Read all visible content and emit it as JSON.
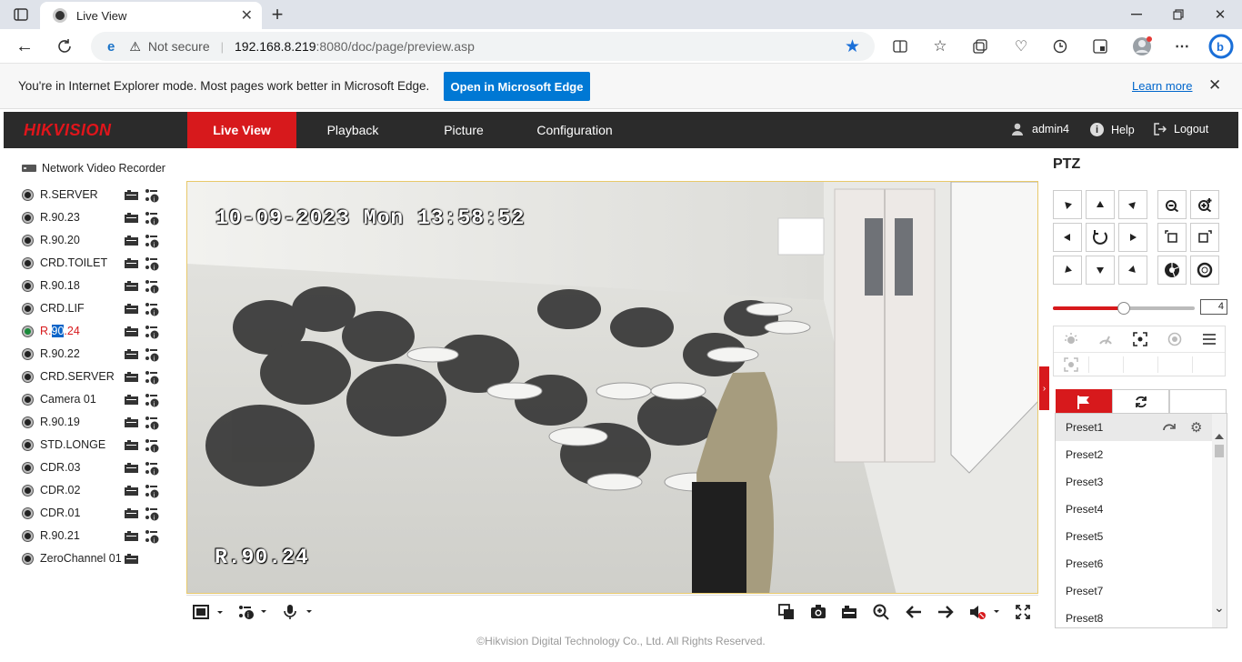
{
  "browser": {
    "tab_title": "Live View",
    "address_security": "Not secure",
    "address_host": "192.168.8.219",
    "address_rest": ":8080/doc/page/preview.asp"
  },
  "ie_banner": {
    "message": "You're in Internet Explorer mode. Most pages work better in Microsoft Edge.",
    "open_button": "Open in Microsoft Edge",
    "learn_more": "Learn more"
  },
  "app": {
    "logo": "HIKVISION",
    "nav": [
      "Live View",
      "Playback",
      "Picture",
      "Configuration"
    ],
    "active_nav": "Live View",
    "user": "admin4",
    "help": "Help",
    "logout": "Logout"
  },
  "tree": {
    "root": "Network Video Recorder",
    "cameras": [
      {
        "name": "R.SERVER"
      },
      {
        "name": "R.90.23"
      },
      {
        "name": "R.90.20"
      },
      {
        "name": "CRD.TOILET"
      },
      {
        "name": "R.90.18"
      },
      {
        "name": "CRD.LIF"
      },
      {
        "name_pre": "R.",
        "name_sel": "90",
        "name_post": ".24",
        "active": true
      },
      {
        "name": "R.90.22"
      },
      {
        "name": "CRD.SERVER"
      },
      {
        "name": "Camera 01"
      },
      {
        "name": "R.90.19"
      },
      {
        "name": "STD.LONGE"
      },
      {
        "name": "CDR.03"
      },
      {
        "name": "CDR.02"
      },
      {
        "name": "CDR.01"
      },
      {
        "name": "R.90.21"
      }
    ],
    "zero_channel": "ZeroChannel 01"
  },
  "video": {
    "timestamp": "10-09-2023 Mon 13:58:52",
    "camera_name": "R.90.24"
  },
  "ptz": {
    "title": "PTZ",
    "speed": "4",
    "speed_fraction": 0.5,
    "presets": [
      "Preset1",
      "Preset2",
      "Preset3",
      "Preset4",
      "Preset5",
      "Preset6",
      "Preset7",
      "Preset8"
    ]
  },
  "footer": "©Hikvision Digital Technology Co., Ltd. All Rights Reserved.",
  "colors": {
    "accent_red": "#d7191c",
    "header_dark": "#2b2b2b",
    "edge_blue": "#0078d4"
  }
}
